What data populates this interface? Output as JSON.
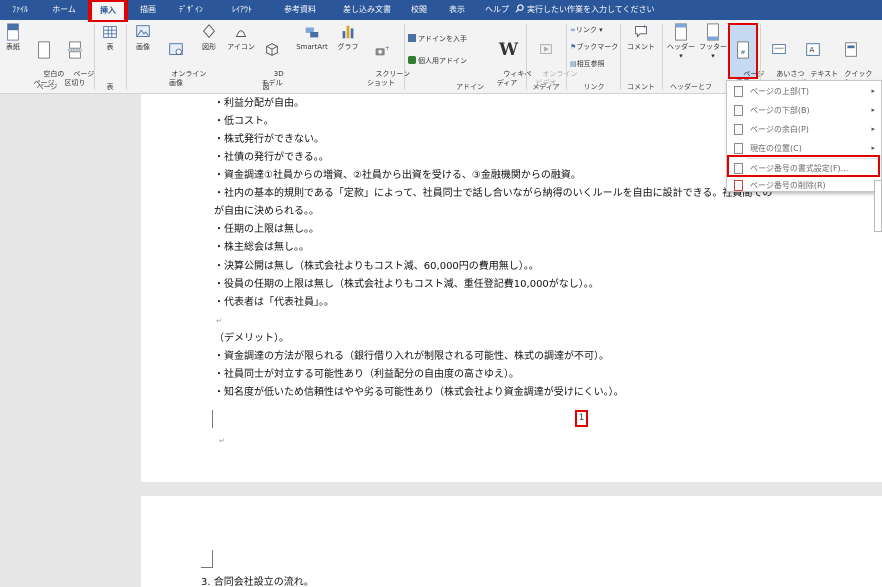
{
  "menubar": {
    "tabs": [
      "ﾌｧｲﾙ",
      "ホーム",
      "挿入",
      "描画",
      "ﾃﾞｻﾞｲﾝ",
      "ﾚｲｱｳﾄ",
      "参考資料",
      "差し込み文書",
      "校閲",
      "表示",
      "ヘルプ"
    ],
    "tell_me": "実行したい作業を入力してください",
    "tell_me_icon": "search-icon"
  },
  "ribbon": {
    "pages_group": {
      "label": "ページ",
      "cover": "表紙",
      "blank": "空白の\nページ",
      "break": "ページ\n区切り"
    },
    "table_group": {
      "label": "表",
      "table": "表"
    },
    "illust_group": {
      "label": "図",
      "image": "画像",
      "online_image": "オンライン\n画像",
      "shapes": "図形",
      "icons": "アイコン",
      "model3d": "3D\nモデル",
      "smartart": "SmartArt",
      "chart": "グラフ",
      "screenshot": "スクリーン\nショット"
    },
    "addin_group": {
      "label": "アドイン",
      "get_addin": "アドインを入手",
      "personal_addin": "個人用アドイン",
      "wikipedia": "ウィキペ\nディア"
    },
    "media_group": {
      "label": "メディア",
      "online_video": "オンライン\nビデオ"
    },
    "link_group": {
      "label": "リンク",
      "link": "リンク",
      "bookmark": "ブックマーク",
      "crossref": "相互参照"
    },
    "comment_group": {
      "label": "コメント",
      "comment": "コメント"
    },
    "hf_group": {
      "label": "ヘッダーとフ",
      "header": "ヘッダー",
      "footer": "フッター",
      "page_number": "ページ\n番号"
    },
    "text_group": {
      "greeting": "あいさつ\n文",
      "textbox": "テキスト\nボックス",
      "quickparts": "クイック\nパーツ"
    }
  },
  "document": {
    "lines": [
      "・利益分配が自由。",
      "・低コスト。",
      "・株式発行ができない。",
      "・社債の発行ができる。。",
      "・資金調達①社員からの増資、②社員から出資を受ける、③金融機関からの融資。",
      "・社内の基本的規則である「定款」によって、社員同士で話し合いながら納得のいくルールを自由に設計できる。社員間での",
      "が自由に決められる。。",
      "・任期の上限は無し。。",
      "・株主総会は無し。。",
      "・決算公開は無し（株式会社よりもコスト減、60,000円の費用無し）。。",
      "・役員の任期の上限は無し（株式会社よりもコスト減、重任登記費10,000がなし）。。",
      "・代表者は「代表社員」。。",
      "",
      "（デメリット）。",
      "・資金調達の方法が限られる（銀行借り入れが制限される可能性、株式の調達が不可）。",
      "・社員同士が対立する可能性あり（利益配分の自由度の高さゆえ）。",
      "・知名度が低いため信頼性はやや劣る可能性あり（株式会社より資金調達が受けにくい。）。"
    ],
    "page_number": "1",
    "page2_heading": "3. 合同会社設立の流れ。"
  },
  "dropdown": {
    "items": [
      {
        "label": "ページの上部(T)",
        "arrow": "▸"
      },
      {
        "label": "ページの下部(B)",
        "arrow": "▸"
      },
      {
        "label": "ページの余白(P)",
        "arrow": "▸"
      },
      {
        "label": "現在の位置(C)",
        "arrow": "▸"
      },
      {
        "label": "ページ番号の書式設定(F)...",
        "arrow": ""
      },
      {
        "label": "ページ番号の削除(R)",
        "arrow": ""
      }
    ]
  },
  "colors": {
    "brand": "#2b579a",
    "highlight": "#e00000",
    "ribbon_bg": "#f3f3f3"
  }
}
